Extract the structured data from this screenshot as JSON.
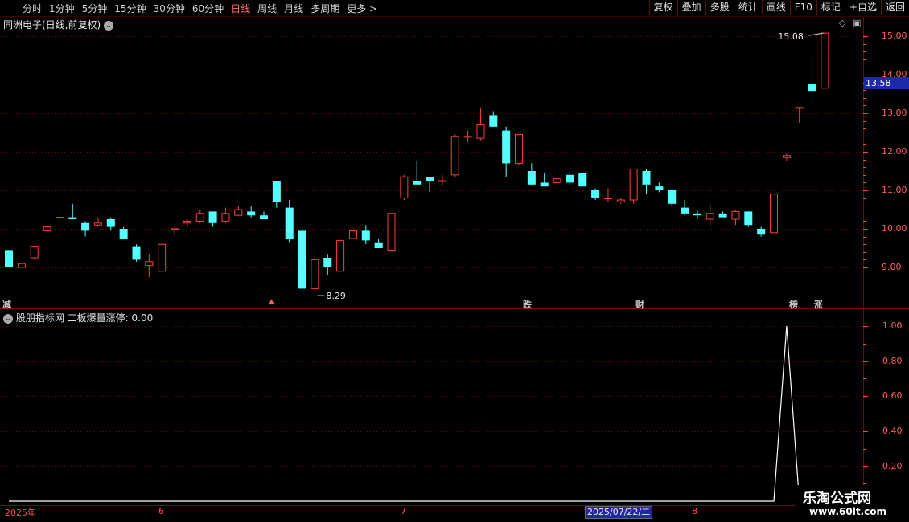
{
  "toolbar": {
    "left_items": [
      "分时",
      "1分钟",
      "5分钟",
      "15分钟",
      "30分钟",
      "60分钟",
      "日线",
      "周线",
      "月线",
      "多周期",
      "更多 >"
    ],
    "active": "日线",
    "right_items": [
      "复权",
      "叠加",
      "多股",
      "统计",
      "画线",
      "F10",
      "标记",
      "+自选",
      "返回"
    ]
  },
  "stock": {
    "title": "同洲电子(日线,前复权)"
  },
  "indicator": {
    "title": "股朋指标网  二板爆量涨停: 0.00"
  },
  "price_axis": [
    "15.00",
    "14.00",
    "13.00",
    "12.00",
    "11.00",
    "10.00",
    "9.00"
  ],
  "indicator_axis": [
    "1.00",
    "0.80",
    "0.60",
    "0.40",
    "0.20"
  ],
  "current_price": "13.58",
  "annotations": {
    "high": "15.08",
    "low": "8.29"
  },
  "signals": [
    {
      "text": "减",
      "color": "#60e060"
    },
    {
      "text": "跌",
      "color": "#60e060"
    },
    {
      "text": "财",
      "color": "#70d8ff"
    },
    {
      "text": "榜",
      "color": "#ffa040"
    },
    {
      "text": "涨",
      "color": "#ff5050"
    }
  ],
  "date_axis": {
    "year": "2025年",
    "months": [
      "6",
      "7",
      "8"
    ],
    "cursor_date": "2025/07/22/二"
  },
  "watermark": {
    "line1": "乐淘公式网",
    "line2": "www.60lt.com"
  },
  "colors": {
    "up": "#ff3c3c",
    "down": "#54ffff",
    "grid": "#7a0000",
    "indicator_line": "#ffffff"
  },
  "chart_data": {
    "type": "candlestick",
    "candles": [
      [
        9.45,
        9.45,
        9.0,
        9.0
      ],
      [
        9.0,
        9.1,
        9.0,
        9.1
      ],
      [
        9.25,
        9.55,
        9.2,
        9.55
      ],
      [
        9.95,
        10.05,
        9.95,
        10.05
      ],
      [
        10.3,
        10.45,
        9.95,
        10.3
      ],
      [
        10.3,
        10.65,
        10.25,
        10.25
      ],
      [
        10.15,
        10.2,
        9.8,
        9.95
      ],
      [
        10.1,
        10.3,
        10.05,
        10.15
      ],
      [
        10.25,
        10.3,
        9.95,
        10.05
      ],
      [
        10.0,
        10.05,
        9.75,
        9.75
      ],
      [
        9.55,
        9.6,
        9.15,
        9.2
      ],
      [
        9.05,
        9.35,
        8.75,
        9.15
      ],
      [
        8.9,
        9.65,
        8.9,
        9.6
      ],
      [
        10.0,
        10.0,
        9.85,
        10.0
      ],
      [
        10.15,
        10.25,
        10.05,
        10.2
      ],
      [
        10.2,
        10.5,
        10.15,
        10.4
      ],
      [
        10.45,
        10.45,
        10.05,
        10.15
      ],
      [
        10.2,
        10.55,
        10.15,
        10.4
      ],
      [
        10.35,
        10.6,
        10.35,
        10.5
      ],
      [
        10.45,
        10.6,
        10.3,
        10.35
      ],
      [
        10.35,
        10.45,
        10.25,
        10.25
      ],
      [
        11.25,
        11.25,
        10.55,
        10.7
      ],
      [
        10.55,
        10.75,
        9.65,
        9.75
      ],
      [
        9.95,
        10.0,
        8.4,
        8.45
      ],
      [
        8.45,
        9.45,
        8.3,
        9.2
      ],
      [
        9.25,
        9.35,
        8.8,
        9.0
      ],
      [
        8.9,
        9.7,
        8.9,
        9.7
      ],
      [
        9.75,
        9.95,
        9.75,
        9.95
      ],
      [
        9.95,
        10.1,
        9.6,
        9.7
      ],
      [
        9.65,
        9.75,
        9.5,
        9.5
      ],
      [
        9.45,
        10.4,
        9.45,
        10.4
      ],
      [
        10.8,
        11.4,
        10.75,
        11.35
      ],
      [
        11.25,
        11.75,
        11.2,
        11.15
      ],
      [
        11.35,
        11.35,
        10.95,
        11.25
      ],
      [
        11.25,
        11.4,
        11.1,
        11.25
      ],
      [
        11.4,
        12.45,
        11.35,
        12.4
      ],
      [
        12.4,
        12.55,
        12.25,
        12.4
      ],
      [
        12.35,
        13.15,
        12.3,
        12.7
      ],
      [
        12.95,
        13.05,
        12.65,
        12.65
      ],
      [
        12.55,
        12.65,
        11.35,
        11.7
      ],
      [
        11.7,
        12.45,
        11.65,
        12.45
      ],
      [
        11.5,
        11.7,
        11.15,
        11.15
      ],
      [
        11.2,
        11.45,
        11.1,
        11.1
      ],
      [
        11.2,
        11.35,
        11.15,
        11.3
      ],
      [
        11.4,
        11.5,
        11.1,
        11.2
      ],
      [
        11.45,
        11.45,
        11.1,
        11.1
      ],
      [
        11.0,
        11.05,
        10.75,
        10.8
      ],
      [
        10.8,
        11.05,
        10.7,
        10.8
      ],
      [
        10.7,
        10.8,
        10.65,
        10.75
      ],
      [
        10.75,
        11.55,
        10.65,
        11.55
      ],
      [
        11.5,
        11.55,
        10.9,
        11.15
      ],
      [
        11.1,
        11.2,
        10.95,
        11.0
      ],
      [
        11.0,
        11.0,
        10.6,
        10.65
      ],
      [
        10.55,
        10.75,
        10.35,
        10.4
      ],
      [
        10.4,
        10.5,
        10.25,
        10.35
      ],
      [
        10.25,
        10.65,
        10.05,
        10.4
      ],
      [
        10.4,
        10.45,
        10.3,
        10.3
      ],
      [
        10.25,
        10.5,
        10.1,
        10.45
      ],
      [
        10.45,
        10.45,
        10.05,
        10.1
      ],
      [
        10.0,
        10.05,
        9.8,
        9.85
      ],
      [
        9.9,
        10.9,
        9.9,
        10.9
      ],
      [
        11.85,
        11.95,
        11.75,
        11.9
      ],
      [
        13.15,
        13.15,
        12.75,
        13.15
      ],
      [
        13.75,
        14.45,
        13.2,
        13.58
      ],
      [
        13.65,
        15.08,
        13.65,
        15.08
      ]
    ],
    "candle_order": "open,high,low,close",
    "high_label": 15.08,
    "low_label": 8.29,
    "y_axis": [
      9.0,
      10.0,
      11.0,
      12.0,
      13.0,
      14.0,
      15.0
    ],
    "indicator_series": {
      "name": "二板爆量涨停",
      "values": [
        0,
        0,
        0,
        0,
        0,
        0,
        0,
        0,
        0,
        0,
        0,
        0,
        0,
        0,
        0,
        0,
        0,
        0,
        0,
        0,
        0,
        0,
        0,
        0,
        0,
        0,
        0,
        0,
        0,
        0,
        0,
        0,
        0,
        0,
        0,
        0,
        0,
        0,
        0,
        0,
        0,
        0,
        0,
        0,
        0,
        0,
        0,
        0,
        0,
        0,
        0,
        0,
        0,
        0,
        0,
        0,
        0,
        0,
        0,
        0,
        0,
        1,
        0,
        0,
        0
      ]
    },
    "indicator_axis": [
      0.2,
      0.4,
      0.6,
      0.8,
      1.0
    ]
  }
}
